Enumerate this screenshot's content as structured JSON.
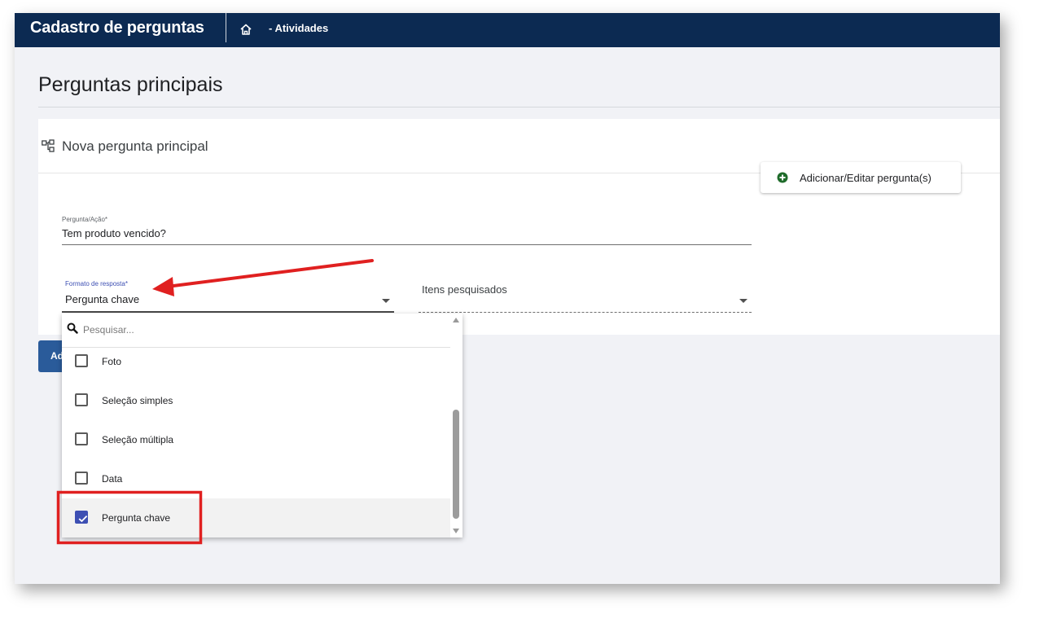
{
  "header": {
    "app_title": "Cadastro de perguntas",
    "breadcrumb": "- Atividades"
  },
  "page": {
    "title": "Perguntas principais"
  },
  "card": {
    "title": "Nova pergunta principal",
    "question_field": {
      "label": "Pergunta/Ação*",
      "value": "Tem produto vencido?"
    },
    "format_field": {
      "label": "Formato de resposta*",
      "value": "Pergunta chave"
    },
    "items_field": {
      "placeholder": "Itens pesquisados"
    },
    "add_button": "Adicionar/Editar pergunta(s)"
  },
  "side_button": {
    "label": "Ad"
  },
  "dropdown": {
    "search_placeholder": "Pesquisar...",
    "options": [
      {
        "label": "Foto",
        "checked": false
      },
      {
        "label": "Seleção simples",
        "checked": false
      },
      {
        "label": "Seleção múltipla",
        "checked": false
      },
      {
        "label": "Data",
        "checked": false
      },
      {
        "label": "Pergunta chave",
        "checked": true
      }
    ]
  },
  "colors": {
    "topbar": "#0c2a52",
    "checkbox_checked": "#3d4fb3",
    "annotation_red": "#e02020",
    "plus_icon": "#1e6b2a"
  }
}
